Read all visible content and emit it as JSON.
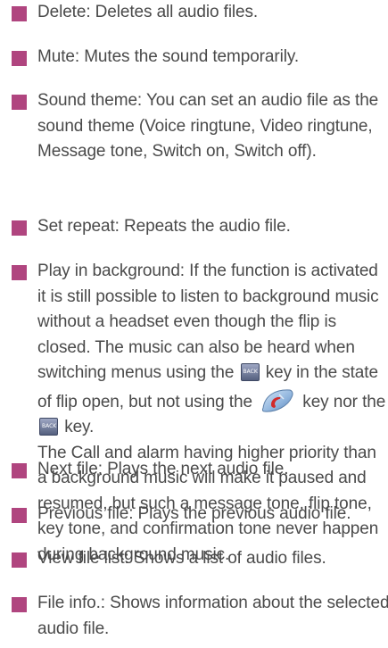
{
  "colors": {
    "bullet": "#b0457f",
    "text": "#4a4a4a"
  },
  "items": [
    {
      "text": "Delete: Deletes all audio files."
    },
    {
      "text": "Mute: Mutes the sound temporarily."
    },
    {
      "text": "Sound theme: You can set an audio file as the sound theme (Voice ringtune, Video ringtune, Message tone, Switch on, Switch off)."
    },
    {
      "text": "Set repeat: Repeats the audio file."
    },
    {
      "part1": "Play in background: If the function is activated it is still possible to listen to background music without a headset even though the flip is closed. The music can also be heard when switching menus using the",
      "part2": "key in the state of flip open, but not using the",
      "part3": "key nor the",
      "part4": "key.",
      "part5": "The Call and alarm having higher priority than a background music will make it paused and resumed, but such a message tone, flip tone, key tone, and confirmation tone never happen during background music."
    },
    {
      "text": "Next file: Plays the next audio file."
    },
    {
      "text": "Previous file: Plays the previous audio file."
    },
    {
      "text": "View file list: Shows a list of audio files."
    },
    {
      "text": "File info.: Shows information about the selected audio file."
    }
  ],
  "key_labels": {
    "back": "BACK"
  },
  "icons": {
    "bullet": "square-bullet-icon",
    "back_key": "back-key-icon",
    "end_key": "end-call-key-icon"
  }
}
